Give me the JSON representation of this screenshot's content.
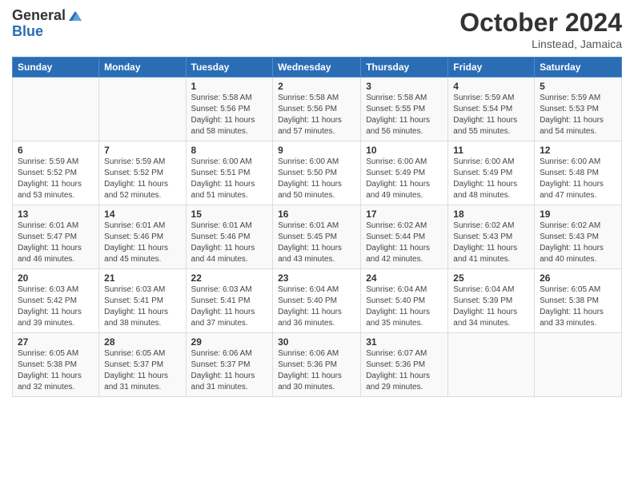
{
  "logo": {
    "general": "General",
    "blue": "Blue"
  },
  "header": {
    "month": "October 2024",
    "location": "Linstead, Jamaica"
  },
  "weekdays": [
    "Sunday",
    "Monday",
    "Tuesday",
    "Wednesday",
    "Thursday",
    "Friday",
    "Saturday"
  ],
  "weeks": [
    [
      {
        "day": "",
        "sunrise": "",
        "sunset": "",
        "daylight": ""
      },
      {
        "day": "",
        "sunrise": "",
        "sunset": "",
        "daylight": ""
      },
      {
        "day": "1",
        "sunrise": "Sunrise: 5:58 AM",
        "sunset": "Sunset: 5:56 PM",
        "daylight": "Daylight: 11 hours and 58 minutes."
      },
      {
        "day": "2",
        "sunrise": "Sunrise: 5:58 AM",
        "sunset": "Sunset: 5:56 PM",
        "daylight": "Daylight: 11 hours and 57 minutes."
      },
      {
        "day": "3",
        "sunrise": "Sunrise: 5:58 AM",
        "sunset": "Sunset: 5:55 PM",
        "daylight": "Daylight: 11 hours and 56 minutes."
      },
      {
        "day": "4",
        "sunrise": "Sunrise: 5:59 AM",
        "sunset": "Sunset: 5:54 PM",
        "daylight": "Daylight: 11 hours and 55 minutes."
      },
      {
        "day": "5",
        "sunrise": "Sunrise: 5:59 AM",
        "sunset": "Sunset: 5:53 PM",
        "daylight": "Daylight: 11 hours and 54 minutes."
      }
    ],
    [
      {
        "day": "6",
        "sunrise": "Sunrise: 5:59 AM",
        "sunset": "Sunset: 5:52 PM",
        "daylight": "Daylight: 11 hours and 53 minutes."
      },
      {
        "day": "7",
        "sunrise": "Sunrise: 5:59 AM",
        "sunset": "Sunset: 5:52 PM",
        "daylight": "Daylight: 11 hours and 52 minutes."
      },
      {
        "day": "8",
        "sunrise": "Sunrise: 6:00 AM",
        "sunset": "Sunset: 5:51 PM",
        "daylight": "Daylight: 11 hours and 51 minutes."
      },
      {
        "day": "9",
        "sunrise": "Sunrise: 6:00 AM",
        "sunset": "Sunset: 5:50 PM",
        "daylight": "Daylight: 11 hours and 50 minutes."
      },
      {
        "day": "10",
        "sunrise": "Sunrise: 6:00 AM",
        "sunset": "Sunset: 5:49 PM",
        "daylight": "Daylight: 11 hours and 49 minutes."
      },
      {
        "day": "11",
        "sunrise": "Sunrise: 6:00 AM",
        "sunset": "Sunset: 5:49 PM",
        "daylight": "Daylight: 11 hours and 48 minutes."
      },
      {
        "day": "12",
        "sunrise": "Sunrise: 6:00 AM",
        "sunset": "Sunset: 5:48 PM",
        "daylight": "Daylight: 11 hours and 47 minutes."
      }
    ],
    [
      {
        "day": "13",
        "sunrise": "Sunrise: 6:01 AM",
        "sunset": "Sunset: 5:47 PM",
        "daylight": "Daylight: 11 hours and 46 minutes."
      },
      {
        "day": "14",
        "sunrise": "Sunrise: 6:01 AM",
        "sunset": "Sunset: 5:46 PM",
        "daylight": "Daylight: 11 hours and 45 minutes."
      },
      {
        "day": "15",
        "sunrise": "Sunrise: 6:01 AM",
        "sunset": "Sunset: 5:46 PM",
        "daylight": "Daylight: 11 hours and 44 minutes."
      },
      {
        "day": "16",
        "sunrise": "Sunrise: 6:01 AM",
        "sunset": "Sunset: 5:45 PM",
        "daylight": "Daylight: 11 hours and 43 minutes."
      },
      {
        "day": "17",
        "sunrise": "Sunrise: 6:02 AM",
        "sunset": "Sunset: 5:44 PM",
        "daylight": "Daylight: 11 hours and 42 minutes."
      },
      {
        "day": "18",
        "sunrise": "Sunrise: 6:02 AM",
        "sunset": "Sunset: 5:43 PM",
        "daylight": "Daylight: 11 hours and 41 minutes."
      },
      {
        "day": "19",
        "sunrise": "Sunrise: 6:02 AM",
        "sunset": "Sunset: 5:43 PM",
        "daylight": "Daylight: 11 hours and 40 minutes."
      }
    ],
    [
      {
        "day": "20",
        "sunrise": "Sunrise: 6:03 AM",
        "sunset": "Sunset: 5:42 PM",
        "daylight": "Daylight: 11 hours and 39 minutes."
      },
      {
        "day": "21",
        "sunrise": "Sunrise: 6:03 AM",
        "sunset": "Sunset: 5:41 PM",
        "daylight": "Daylight: 11 hours and 38 minutes."
      },
      {
        "day": "22",
        "sunrise": "Sunrise: 6:03 AM",
        "sunset": "Sunset: 5:41 PM",
        "daylight": "Daylight: 11 hours and 37 minutes."
      },
      {
        "day": "23",
        "sunrise": "Sunrise: 6:04 AM",
        "sunset": "Sunset: 5:40 PM",
        "daylight": "Daylight: 11 hours and 36 minutes."
      },
      {
        "day": "24",
        "sunrise": "Sunrise: 6:04 AM",
        "sunset": "Sunset: 5:40 PM",
        "daylight": "Daylight: 11 hours and 35 minutes."
      },
      {
        "day": "25",
        "sunrise": "Sunrise: 6:04 AM",
        "sunset": "Sunset: 5:39 PM",
        "daylight": "Daylight: 11 hours and 34 minutes."
      },
      {
        "day": "26",
        "sunrise": "Sunrise: 6:05 AM",
        "sunset": "Sunset: 5:38 PM",
        "daylight": "Daylight: 11 hours and 33 minutes."
      }
    ],
    [
      {
        "day": "27",
        "sunrise": "Sunrise: 6:05 AM",
        "sunset": "Sunset: 5:38 PM",
        "daylight": "Daylight: 11 hours and 32 minutes."
      },
      {
        "day": "28",
        "sunrise": "Sunrise: 6:05 AM",
        "sunset": "Sunset: 5:37 PM",
        "daylight": "Daylight: 11 hours and 31 minutes."
      },
      {
        "day": "29",
        "sunrise": "Sunrise: 6:06 AM",
        "sunset": "Sunset: 5:37 PM",
        "daylight": "Daylight: 11 hours and 31 minutes."
      },
      {
        "day": "30",
        "sunrise": "Sunrise: 6:06 AM",
        "sunset": "Sunset: 5:36 PM",
        "daylight": "Daylight: 11 hours and 30 minutes."
      },
      {
        "day": "31",
        "sunrise": "Sunrise: 6:07 AM",
        "sunset": "Sunset: 5:36 PM",
        "daylight": "Daylight: 11 hours and 29 minutes."
      },
      {
        "day": "",
        "sunrise": "",
        "sunset": "",
        "daylight": ""
      },
      {
        "day": "",
        "sunrise": "",
        "sunset": "",
        "daylight": ""
      }
    ]
  ]
}
